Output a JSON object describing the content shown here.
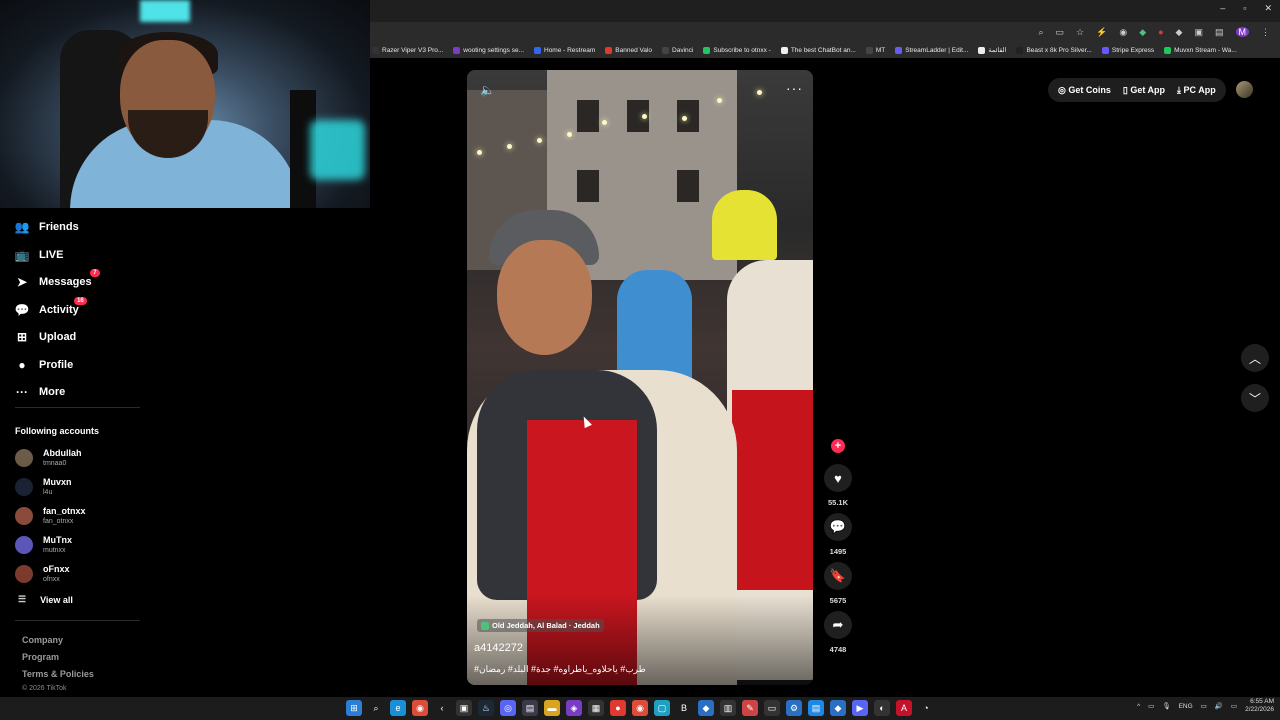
{
  "browser": {
    "window_controls": [
      "–",
      "▫",
      "✕"
    ],
    "bookmarks": [
      {
        "label": "Razer Viper V3 Pro...",
        "color": "#333333"
      },
      {
        "label": "wooting settings se...",
        "color": "#7a3cc4"
      },
      {
        "label": "Home - Restream",
        "color": "#3466f2"
      },
      {
        "label": "Banned Valo",
        "color": "#e0392f"
      },
      {
        "label": "Davinci",
        "color": "#444444"
      },
      {
        "label": "Subscribe to otnxx -",
        "color": "#22c55e"
      },
      {
        "label": "The best ChatBot an...",
        "color": "#f0f0f0"
      },
      {
        "label": "MT",
        "color": "#444444"
      },
      {
        "label": "StreamLadder | Edit...",
        "color": "#6a5cf0"
      },
      {
        "label": "القائمة",
        "color": "#eeeeee"
      },
      {
        "label": "Beast x 8k Pro Silver...",
        "color": "#222222"
      },
      {
        "label": "Stripe Express",
        "color": "#635bff"
      },
      {
        "label": "Muvxn Stream - Wa...",
        "color": "#22c55e"
      }
    ]
  },
  "sidebar": {
    "nav": [
      {
        "label": "Friends",
        "icon": "friends-icon",
        "glyph": "👥",
        "badge": ""
      },
      {
        "label": "LIVE",
        "icon": "live-icon",
        "glyph": "📺",
        "badge": ""
      },
      {
        "label": "Messages",
        "icon": "messages-icon",
        "glyph": "➤",
        "badge": "7"
      },
      {
        "label": "Activity",
        "icon": "activity-icon",
        "glyph": "💬",
        "badge": "16"
      },
      {
        "label": "Upload",
        "icon": "upload-icon",
        "glyph": "⊞",
        "badge": ""
      },
      {
        "label": "Profile",
        "icon": "profile-icon",
        "glyph": "●",
        "badge": ""
      },
      {
        "label": "More",
        "icon": "more-icon",
        "glyph": "···",
        "badge": ""
      }
    ],
    "following_title": "Following accounts",
    "accounts": [
      {
        "name": "Abdullah",
        "id": "tmnaa0",
        "color": "#6d5b4a"
      },
      {
        "name": "Muvxn",
        "id": "l4u",
        "color": "#1b2233"
      },
      {
        "name": "fan_otnxx",
        "id": "fan_otnxx",
        "color": "#8a4b3c"
      },
      {
        "name": "MuTnx",
        "id": "mutnxx",
        "color": "#5b57b8"
      },
      {
        "name": "oFnxx",
        "id": "ofnxx",
        "color": "#7a3b2c"
      }
    ],
    "view_all": "View all",
    "footer": [
      "Company",
      "Program",
      "Terms & Policies"
    ],
    "copyright": "© 2026 TikTok"
  },
  "header": {
    "get_coins": "Get Coins",
    "get_app": "Get App",
    "pc_app": "PC App"
  },
  "video": {
    "location": "Old Jeddah, Al Balad · Jeddah",
    "username": "a4142272",
    "caption": "طرب# ياحلاوه_ياطراوه# جدة# البلد# رمضان#",
    "likes": "55.1K",
    "comments": "1495",
    "saves": "5675",
    "shares": "4748"
  },
  "taskbar": {
    "lang": "ENG",
    "time": "6:55 AM",
    "date": "2/22/2026",
    "icons": [
      {
        "name": "windows-start-icon",
        "glyph": "⊞",
        "color": "#2a7fd4"
      },
      {
        "name": "search-icon",
        "glyph": "⌕",
        "color": "#1c1c1c"
      },
      {
        "name": "edge-icon",
        "glyph": "e",
        "color": "#1a8fd6"
      },
      {
        "name": "chrome-icon",
        "glyph": "◉",
        "color": "#dd4b39"
      },
      {
        "name": "back-app-icon",
        "glyph": "‹",
        "color": "#1c1c1c"
      },
      {
        "name": "terminal-icon",
        "glyph": "▣",
        "color": "#333333"
      },
      {
        "name": "steam-icon",
        "glyph": "♨",
        "color": "#1b2838"
      },
      {
        "name": "discord-icon",
        "glyph": "◎",
        "color": "#5865f2"
      },
      {
        "name": "app-icon",
        "glyph": "▤",
        "color": "#3a3a4a"
      },
      {
        "name": "explorer-icon",
        "glyph": "▬",
        "color": "#d9a520"
      },
      {
        "name": "app2-icon",
        "glyph": "◈",
        "color": "#7a3cc4"
      },
      {
        "name": "app3-icon",
        "glyph": "▦",
        "color": "#333333"
      },
      {
        "name": "app4-icon",
        "glyph": "●",
        "color": "#e0392f"
      },
      {
        "name": "app5-icon",
        "glyph": "◉",
        "color": "#dd4b39"
      },
      {
        "name": "app6-icon",
        "glyph": "▢",
        "color": "#20a0c0"
      },
      {
        "name": "app7-icon",
        "glyph": "B",
        "color": "#1c1c1c"
      },
      {
        "name": "app8-icon",
        "glyph": "◆",
        "color": "#2a6fc4"
      },
      {
        "name": "app9-icon",
        "glyph": "▥",
        "color": "#333333"
      },
      {
        "name": "app10-icon",
        "glyph": "✎",
        "color": "#c44"
      },
      {
        "name": "app11-icon",
        "glyph": "▭",
        "color": "#333333"
      },
      {
        "name": "settings-icon",
        "glyph": "⚙",
        "color": "#2a6fc4"
      },
      {
        "name": "app12-icon",
        "glyph": "▤",
        "color": "#1e88e5"
      },
      {
        "name": "app13-icon",
        "glyph": "◆",
        "color": "#2a6fc4"
      },
      {
        "name": "app14-icon",
        "glyph": "▶",
        "color": "#5865f2"
      },
      {
        "name": "app15-icon",
        "glyph": "◐",
        "color": "#333333"
      },
      {
        "name": "app16-icon",
        "glyph": "A",
        "color": "#c4122a"
      },
      {
        "name": "app17-icon",
        "glyph": "◔",
        "color": "#1c1c1c"
      }
    ]
  }
}
